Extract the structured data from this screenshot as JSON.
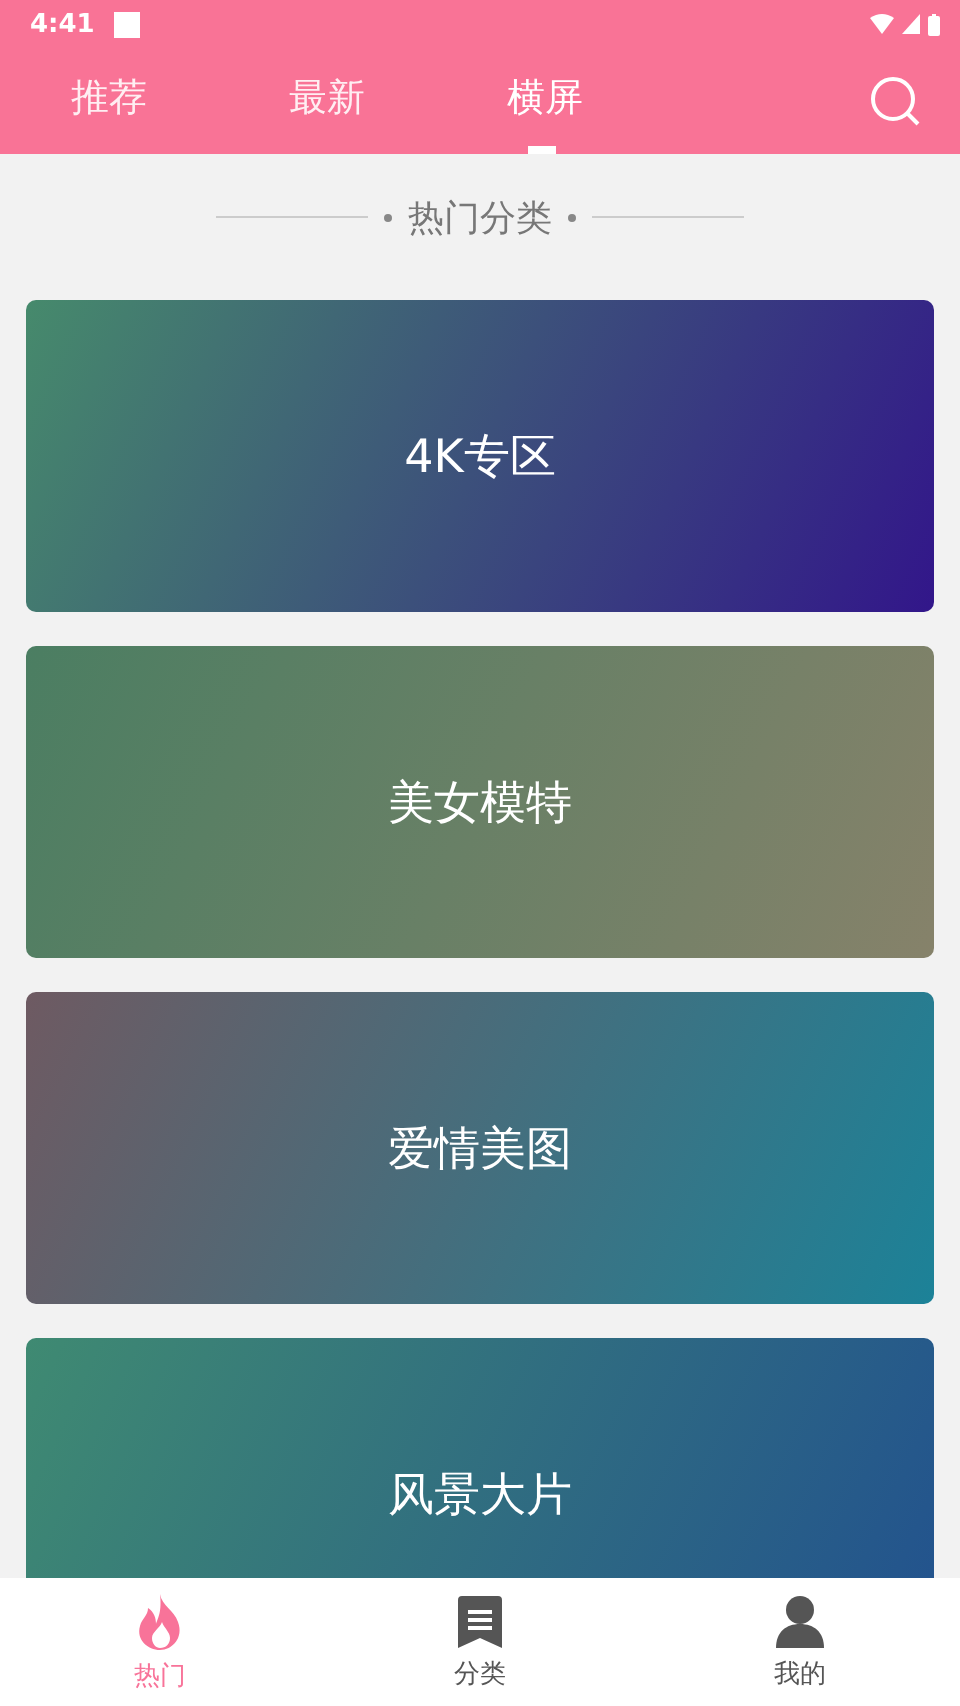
{
  "status_bar": {
    "time": "4:41"
  },
  "tabs": [
    {
      "label": "推荐",
      "selected": false
    },
    {
      "label": "最新",
      "selected": false
    },
    {
      "label": "横屏",
      "selected": true
    }
  ],
  "section_title": "热门分类",
  "categories": [
    {
      "label": "4K专区"
    },
    {
      "label": "美女模特"
    },
    {
      "label": "爱情美图"
    },
    {
      "label": "风景大片"
    }
  ],
  "bottom_nav": [
    {
      "label": "热门",
      "selected": true
    },
    {
      "label": "分类",
      "selected": false
    },
    {
      "label": "我的",
      "selected": false
    }
  ]
}
